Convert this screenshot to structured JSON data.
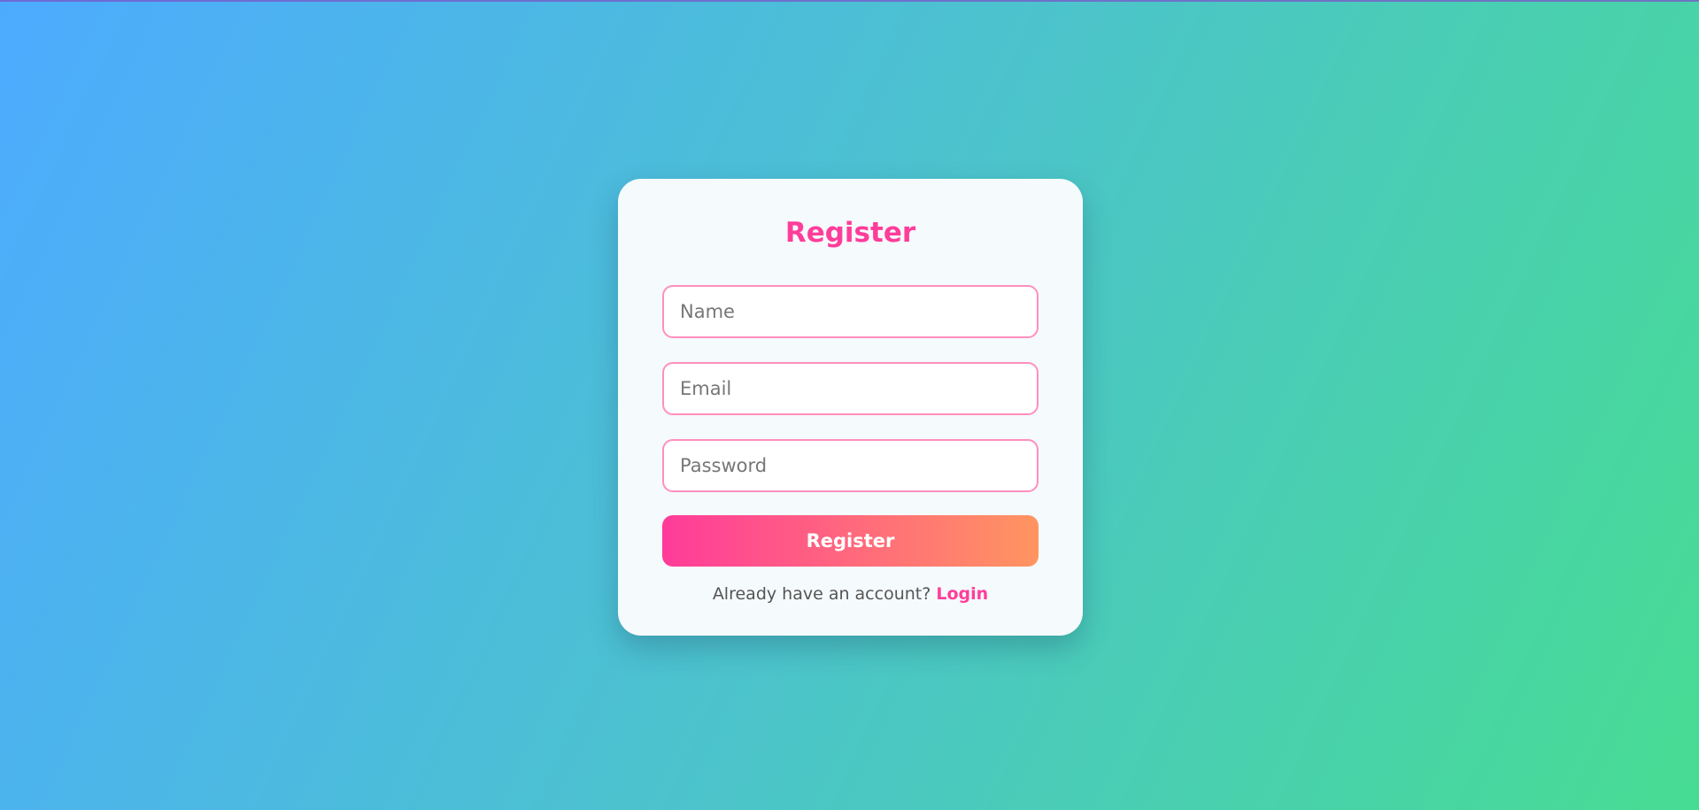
{
  "form": {
    "title": "Register",
    "name_placeholder": "Name",
    "email_placeholder": "Email",
    "password_placeholder": "Password",
    "submit_label": "Register",
    "footer_text": "Already have an account?",
    "login_link": "Login"
  },
  "colors": {
    "accent": "#ff3d9a",
    "button_gradient_start": "#ff3b9a",
    "button_gradient_end": "#ff9560",
    "background_start": "#4dabff",
    "background_end": "#47dc93"
  }
}
